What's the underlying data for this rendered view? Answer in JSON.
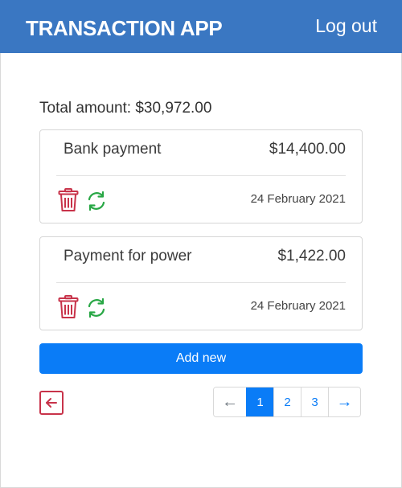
{
  "header": {
    "title": "TRANSACTION APP",
    "logout_label": "Log out"
  },
  "summary": {
    "total_label": "Total amount: $30,972.00"
  },
  "transactions": [
    {
      "name": "Bank payment",
      "amount": "$14,400.00",
      "date": "24 February 2021"
    },
    {
      "name": "Payment for power",
      "amount": "$1,422.00",
      "date": "24 February 2021"
    }
  ],
  "actions": {
    "add_label": "Add new"
  },
  "pagination": {
    "prev_label": "←",
    "next_label": "→",
    "pages": [
      "1",
      "2",
      "3"
    ],
    "active_page": "1"
  },
  "icons": {
    "delete": "trash-icon",
    "repeat": "sync-icon",
    "back": "back-arrow-icon"
  },
  "colors": {
    "header_bg": "#3a77c2",
    "primary": "#0a7cf7",
    "danger": "#c8334a",
    "success": "#28a745"
  }
}
